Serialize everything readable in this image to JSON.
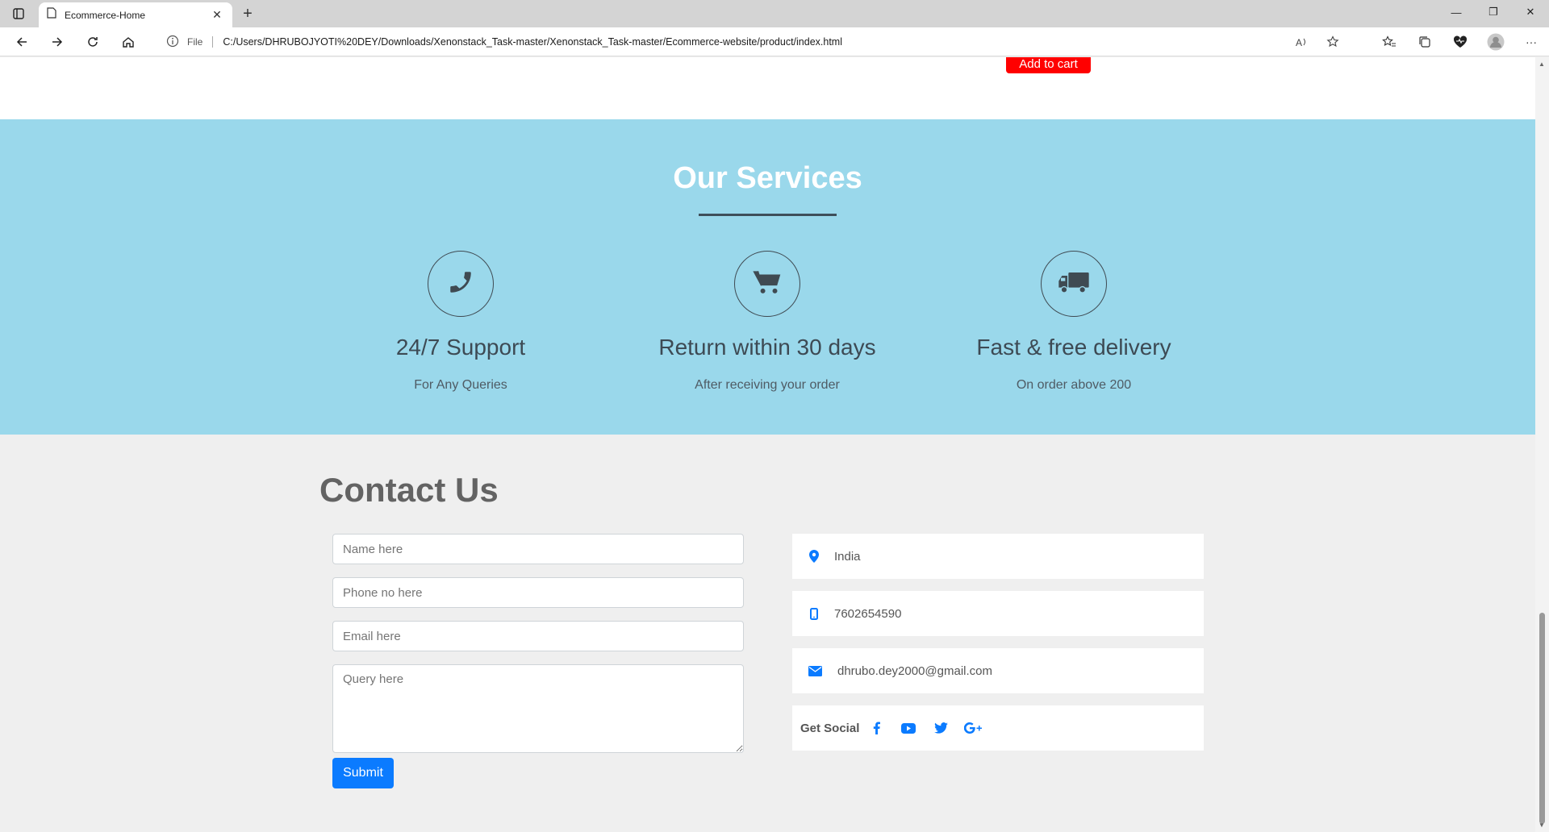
{
  "browser": {
    "tab_title": "Ecommerce-Home",
    "address_prefix": "File",
    "url": "C:/Users/DHRUBOJYOTI%20DEY/Downloads/Xenonstack_Task-master/Xenonstack_Task-master/Ecommerce-website/product/index.html"
  },
  "product": {
    "add_to_cart_label": "Add to cart"
  },
  "services": {
    "title": "Our Services",
    "items": [
      {
        "title": "24/7 Support",
        "subtitle": "For Any Queries",
        "icon": "phone-icon"
      },
      {
        "title": "Return within 30 days",
        "subtitle": "After receiving your order",
        "icon": "cart-icon"
      },
      {
        "title": "Fast & free delivery",
        "subtitle": "On order above 200",
        "icon": "truck-icon"
      }
    ]
  },
  "contact": {
    "title": "Contact Us",
    "form": {
      "name_placeholder": "Name here",
      "phone_placeholder": "Phone no here",
      "email_placeholder": "Email here",
      "query_placeholder": "Query here",
      "submit_label": "Submit"
    },
    "info": {
      "location": "India",
      "phone": "7602654590",
      "email": "dhrubo.dey2000@gmail.com",
      "social_label": "Get Social"
    }
  },
  "colors": {
    "services_bg": "#9ad8eb",
    "accent_blue": "#0b7bff",
    "cart_red": "#ff0000"
  }
}
